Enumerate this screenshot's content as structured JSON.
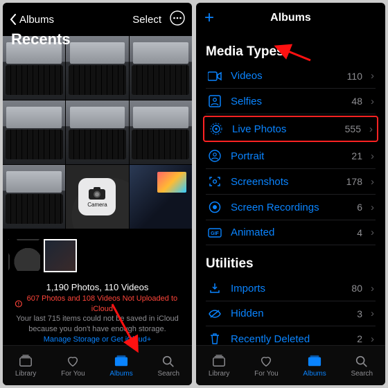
{
  "left": {
    "back_label": "Albums",
    "title": "Recents",
    "select_label": "Select",
    "camera_folder": "Camera",
    "stats": "1,190 Photos, 110 Videos",
    "warn_line1": "607 Photos and 108 Videos Not Uploaded to iCloud",
    "warn_line2": "Your last 715 items could not be saved in iCloud because you don't have enough storage.",
    "warn_link": "Manage Storage or Get iCloud+",
    "tabs": {
      "library": "Library",
      "foryou": "For You",
      "albums": "Albums",
      "search": "Search"
    }
  },
  "right": {
    "title": "Albums",
    "sections": {
      "media": {
        "header": "Media Types",
        "items": [
          {
            "label": "Videos",
            "count": "110"
          },
          {
            "label": "Selfies",
            "count": "48"
          },
          {
            "label": "Live Photos",
            "count": "555"
          },
          {
            "label": "Portrait",
            "count": "21"
          },
          {
            "label": "Screenshots",
            "count": "178"
          },
          {
            "label": "Screen Recordings",
            "count": "6"
          },
          {
            "label": "Animated",
            "count": "4"
          }
        ]
      },
      "util": {
        "header": "Utilities",
        "items": [
          {
            "label": "Imports",
            "count": "80"
          },
          {
            "label": "Hidden",
            "count": "3"
          },
          {
            "label": "Recently Deleted",
            "count": "2"
          }
        ]
      }
    },
    "tabs": {
      "library": "Library",
      "foryou": "For You",
      "albums": "Albums",
      "search": "Search"
    }
  }
}
